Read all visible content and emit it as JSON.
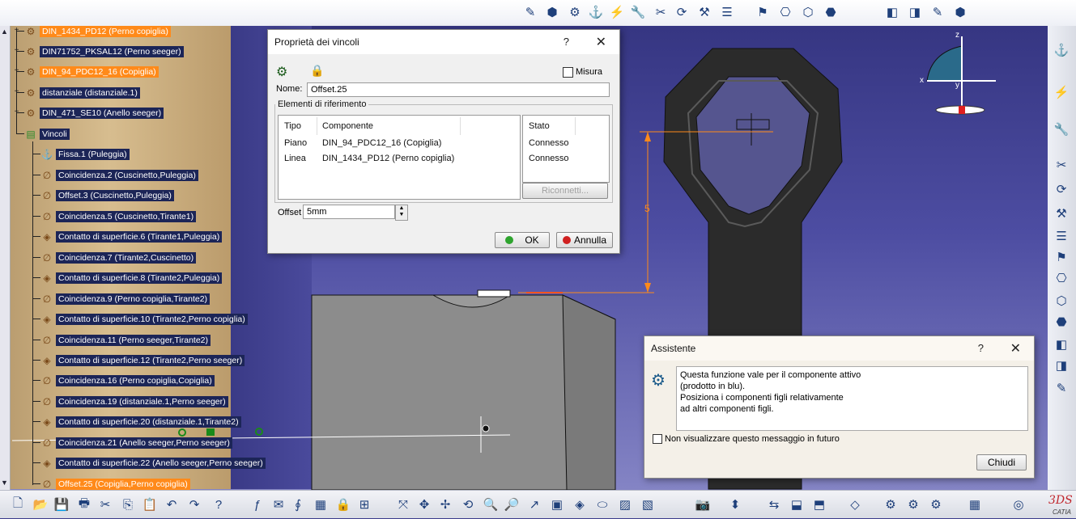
{
  "tree": {
    "items": [
      {
        "label": "DIN_1434_PD12 (Perno copiglia)",
        "style": "orange"
      },
      {
        "label": "DIN71752_PKSAL12 (Perno seeger)",
        "style": "plain"
      },
      {
        "label": "DIN_94_PDC12_16 (Copiglia)",
        "style": "orange"
      },
      {
        "label": "distanziale (distanziale.1)",
        "style": "plain"
      },
      {
        "label": "DIN_471_SE10 (Anello seeger)",
        "style": "plain"
      },
      {
        "label": "Vincoli",
        "style": "plain"
      },
      {
        "label": "Fissa.1 (Puleggia)",
        "style": "plain"
      },
      {
        "label": "Coincidenza.2 (Cuscinetto,Puleggia)",
        "style": "plain"
      },
      {
        "label": "Offset.3 (Cuscinetto,Puleggia)",
        "style": "plain"
      },
      {
        "label": "Coincidenza.5 (Cuscinetto,Tirante1)",
        "style": "plain"
      },
      {
        "label": "Contatto di superficie.6 (Tirante1,Puleggia)",
        "style": "plain"
      },
      {
        "label": "Coincidenza.7 (Tirante2,Cuscinetto)",
        "style": "plain"
      },
      {
        "label": "Contatto di superficie.8 (Tirante2,Puleggia)",
        "style": "plain"
      },
      {
        "label": "Coincidenza.9 (Perno copiglia,Tirante2)",
        "style": "plain"
      },
      {
        "label": "Contatto di superficie.10 (Tirante2,Perno copiglia)",
        "style": "plain"
      },
      {
        "label": "Coincidenza.11 (Perno seeger,Tirante2)",
        "style": "plain"
      },
      {
        "label": "Contatto di superficie.12 (Tirante2,Perno seeger)",
        "style": "plain"
      },
      {
        "label": "Coincidenza.16 (Perno copiglia,Copiglia)",
        "style": "plain"
      },
      {
        "label": "Coincidenza.19 (distanziale.1,Perno seeger)",
        "style": "plain"
      },
      {
        "label": "Contatto di superficie.20 (distanziale.1,Tirante2)",
        "style": "plain"
      },
      {
        "label": "Coincidenza.21 (Anello seeger,Perno seeger)",
        "style": "plain"
      },
      {
        "label": "Contatto di superficie.22 (Anello seeger,Perno seeger)",
        "style": "plain"
      },
      {
        "label": "Offset.25 (Copiglia,Perno copiglia)",
        "style": "orange"
      }
    ]
  },
  "constraint_dialog": {
    "title": "Proprietà dei vincoli",
    "help": "?",
    "close": "✕",
    "measure_label": "Misura",
    "name_label": "Nome:",
    "name_value": "Offset.25",
    "group_label": "Elementi di riferimento",
    "headers": {
      "type": "Tipo",
      "component": "Componente",
      "status": "Stato"
    },
    "rows": [
      {
        "type": "Piano",
        "component": "DIN_94_PDC12_16 (Copiglia)",
        "status": "Connesso"
      },
      {
        "type": "Linea",
        "component": "DIN_1434_PD12 (Perno copiglia)",
        "status": "Connesso"
      }
    ],
    "reconnect": "Riconnetti...",
    "offset_label": "Offset",
    "offset_value": "5mm",
    "ok": "OK",
    "cancel": "Annulla"
  },
  "assistant_dialog": {
    "title": "Assistente",
    "help": "?",
    "close": "✕",
    "message_lines": [
      "Questa funzione vale per il componente attivo",
      "(prodotto in blu).",
      "Posiziona i componenti figli relativamente",
      "ad altri componenti figli."
    ],
    "dont_show": "Non visualizzare questo messaggio in futuro",
    "close_button": "Chiudi"
  },
  "viewport": {
    "dimension_value": "5",
    "compass_labels": {
      "x": "x",
      "y": "y",
      "z": "z"
    }
  },
  "branding": {
    "logo_text": "CATIA"
  },
  "colors": {
    "accent_orange": "#ff8a1a",
    "tree_highlight": "#1c2557",
    "dialog_bg": "#f0f0f0"
  }
}
